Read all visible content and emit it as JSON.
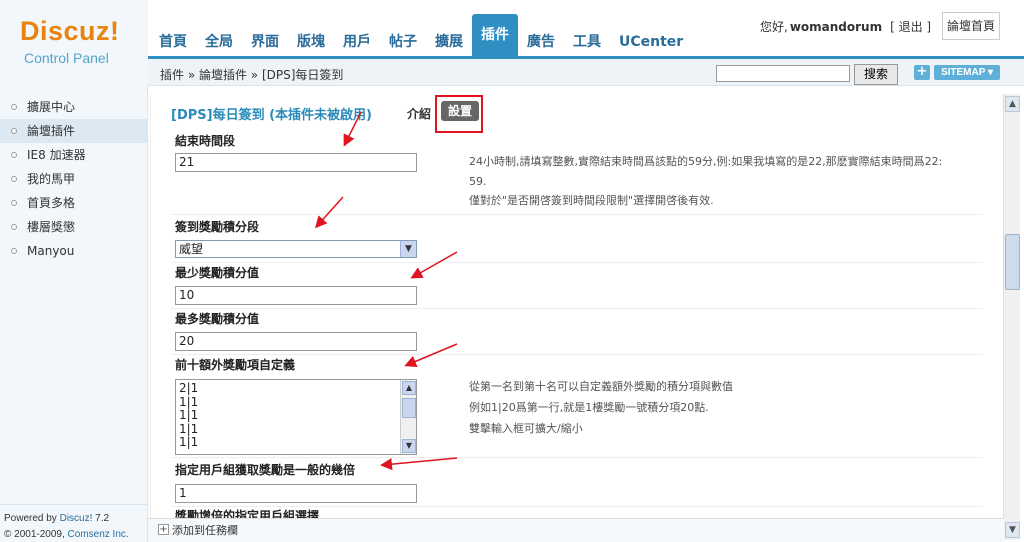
{
  "logo": {
    "brand": "Discuz!",
    "sub": "Control Panel"
  },
  "topnav": [
    {
      "label": "首頁"
    },
    {
      "label": "全局"
    },
    {
      "label": "界面"
    },
    {
      "label": "版塊"
    },
    {
      "label": "用戶"
    },
    {
      "label": "帖子"
    },
    {
      "label": "擴展"
    },
    {
      "label": "插件",
      "active": true
    },
    {
      "label": "廣告"
    },
    {
      "label": "工具"
    },
    {
      "label": "UCenter"
    }
  ],
  "user": {
    "greeting": "您好,",
    "username": "womandorum",
    "logout": "[ 退出 ]",
    "home_button": "論壇首頁"
  },
  "breadcrumb": "插件 » 論壇插件 » [DPS]每日簽到",
  "search": {
    "value": "",
    "button": "搜索"
  },
  "sitemap": {
    "plus": "+",
    "label": "SITEMAP ▾"
  },
  "sidebar": {
    "items": [
      {
        "label": "擴展中心"
      },
      {
        "label": "論壇插件",
        "active": true
      },
      {
        "label": "IE8 加速器"
      },
      {
        "label": "我的馬甲"
      },
      {
        "label": "首頁多格"
      },
      {
        "label": "樓層獎懲"
      },
      {
        "label": "Manyou"
      }
    ],
    "powered_prefix": "Powered by",
    "powered_name": "Discuz!",
    "powered_version": "7.2",
    "copyright_prefix": "© 2001-2009,",
    "copyright_name": "Comsenz Inc."
  },
  "content": {
    "title": "[DPS]每日簽到 (本插件未被啟用)",
    "intro_tab": "介紹",
    "setting_tab": "設置",
    "fields": [
      {
        "label": "結束時間段",
        "value": "21",
        "desc": [
          "24小時制,請填寫整數,實際結束時間爲該點的59分,例:如果我填寫的是22,那麽實際結束時間爲22:",
          "59.",
          "僅對於\"是否開啓簽到時間段限制\"選擇開啓後有效."
        ]
      },
      {
        "label": "簽到獎勵積分段",
        "select_value": "威望"
      },
      {
        "label": "最少獎勵積分值",
        "value": "10"
      },
      {
        "label": "最多獎勵積分值",
        "value": "20"
      },
      {
        "label": "前十額外獎勵項自定義",
        "textarea_lines": [
          "2|1",
          "1|1",
          "1|1",
          "1|1",
          "1|1"
        ],
        "desc": [
          "從第一名到第十名可以自定義額外獎勵的積分項與數值",
          "例如1|20爲第一行,就是1樓獎勵一號積分項20點.",
          "雙擊輸入框可擴大/縮小"
        ]
      },
      {
        "label": "指定用戶組獲取獎勵是一般的幾倍",
        "value": "1"
      },
      {
        "label": "獎勵增倍的指定用戶組選擇"
      }
    ]
  },
  "bottom": {
    "add_label": "添加到任務欄"
  },
  "colors": {
    "accent": "#2f8fc3",
    "annotation_red": "#e0141e",
    "logo_orange": "#e8830e"
  }
}
